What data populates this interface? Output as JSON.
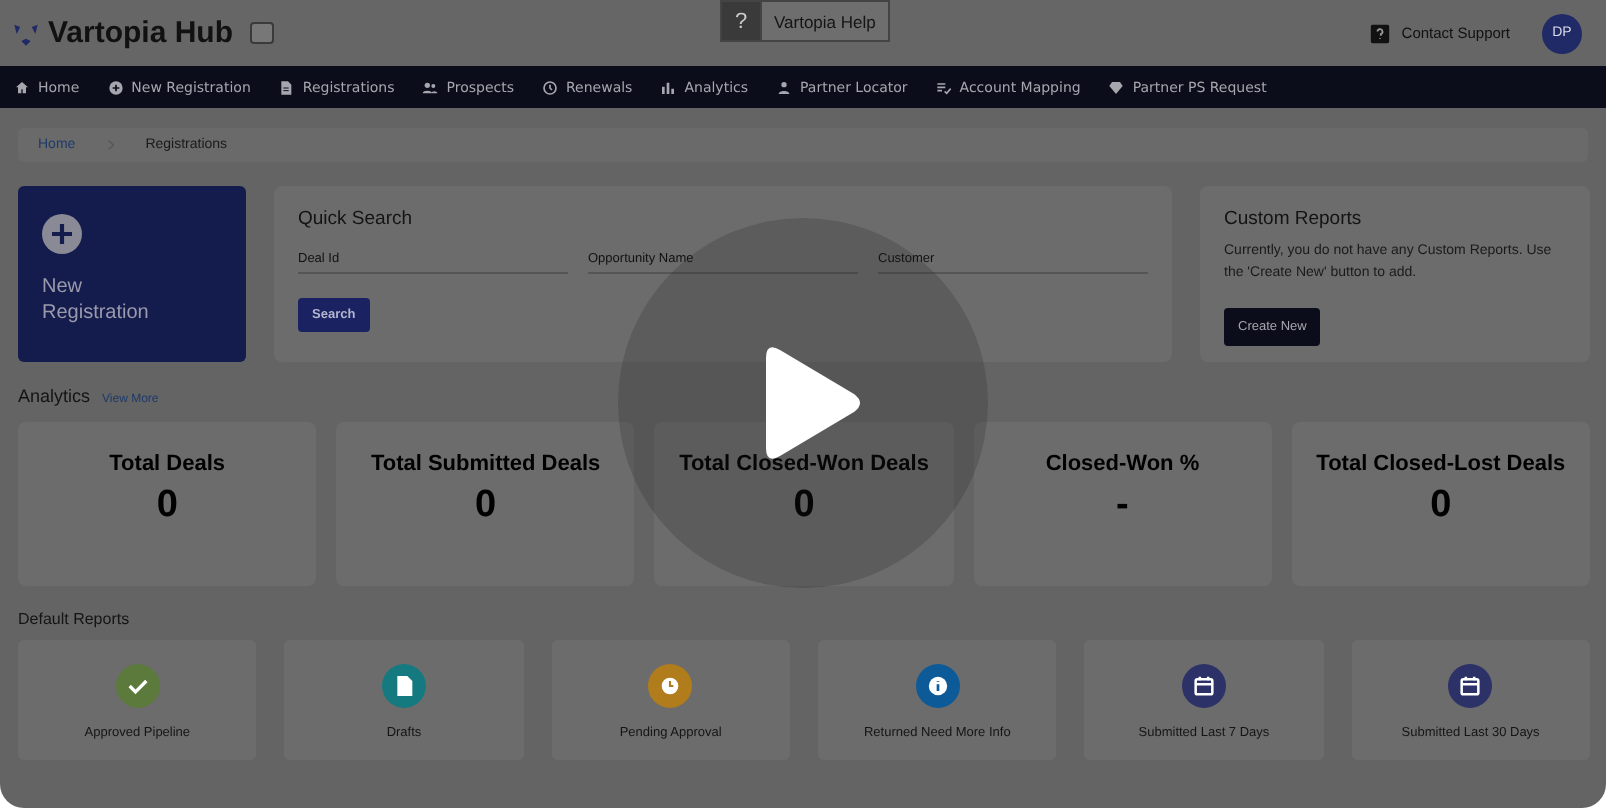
{
  "header": {
    "logo_text": "Vartopia Hub",
    "contact_support": "Contact Support",
    "avatar": "DP"
  },
  "help_badge": {
    "symbol": "?",
    "label": "Vartopia Help"
  },
  "nav": [
    {
      "label": "Home"
    },
    {
      "label": "New Registration"
    },
    {
      "label": "Registrations"
    },
    {
      "label": "Prospects"
    },
    {
      "label": "Renewals"
    },
    {
      "label": "Analytics"
    },
    {
      "label": "Partner Locator"
    },
    {
      "label": "Account Mapping"
    },
    {
      "label": "Partner PS Request"
    }
  ],
  "breadcrumb": [
    {
      "label": "Home",
      "kind": "link"
    },
    {
      "label": "Registrations",
      "kind": "current"
    }
  ],
  "new_registration": "New Registration",
  "quick_search": {
    "title": "Quick Search",
    "fields": [
      {
        "placeholder": "Deal Id"
      },
      {
        "placeholder": "Opportunity Name"
      },
      {
        "placeholder": "Customer"
      }
    ],
    "button": "Search"
  },
  "custom_reports": {
    "title": "Custom Reports",
    "text": "Currently, you do not have any Custom Reports. Use the 'Create New' button to add.",
    "button": "Create New"
  },
  "analytics": {
    "title": "Analytics",
    "link": "View More",
    "stats": [
      {
        "label": "Total Deals",
        "value": "0"
      },
      {
        "label": "Total Submitted Deals",
        "value": "0"
      },
      {
        "label": "Total Closed-Won Deals",
        "value": "0"
      },
      {
        "label": "Closed-Won %",
        "value": "-"
      },
      {
        "label": "Total Closed-Lost Deals",
        "value": "0"
      }
    ]
  },
  "default_reports": {
    "title": "Default Reports",
    "items": [
      {
        "label": "Approved Pipeline",
        "color": "#5b7a3c"
      },
      {
        "label": "Drafts",
        "color": "#157a80"
      },
      {
        "label": "Pending Approval",
        "color": "#b07c1c"
      },
      {
        "label": "Returned Need More Info",
        "color": "#0d5a98"
      },
      {
        "label": "Submitted Last 7 Days",
        "color": "#2c3168"
      },
      {
        "label": "Submitted Last 30 Days",
        "color": "#2c3168"
      }
    ]
  }
}
